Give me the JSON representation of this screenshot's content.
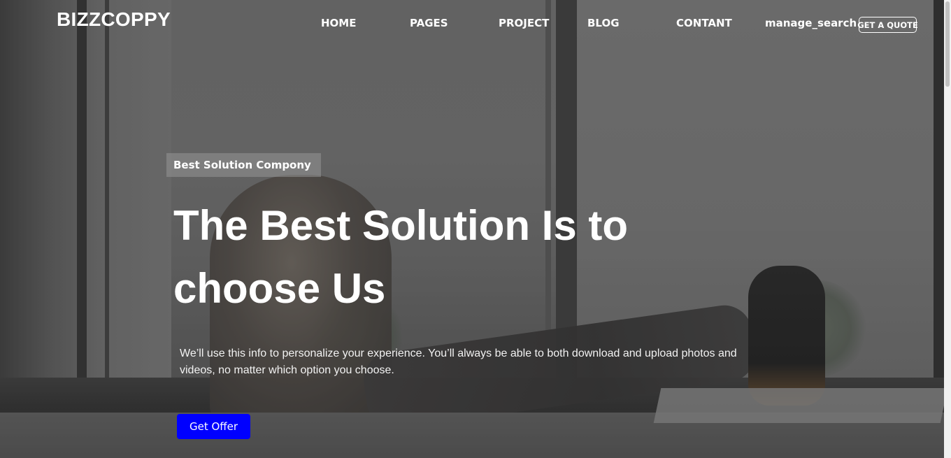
{
  "header": {
    "brand": "BIZZCOPPY",
    "nav": [
      {
        "label": "HOME"
      },
      {
        "label": "PAGES"
      },
      {
        "label": "PROJECT"
      },
      {
        "label": "BLOG"
      },
      {
        "label": "CONTANT"
      }
    ],
    "search_icon_text": "manage_search",
    "quote_button": "GET A QUOTE"
  },
  "hero": {
    "badge": "Best Solution Compony",
    "headline": "The Best Solution Is to choose Us",
    "description": "We’ll use this info to personalize your experience. You’ll always be able to both download and upload photos and videos, no matter which option you choose.",
    "cta": "Get Offer"
  },
  "colors": {
    "cta_background": "#0000ff",
    "text": "#ffffff",
    "overlay": "#6f6f6f"
  }
}
